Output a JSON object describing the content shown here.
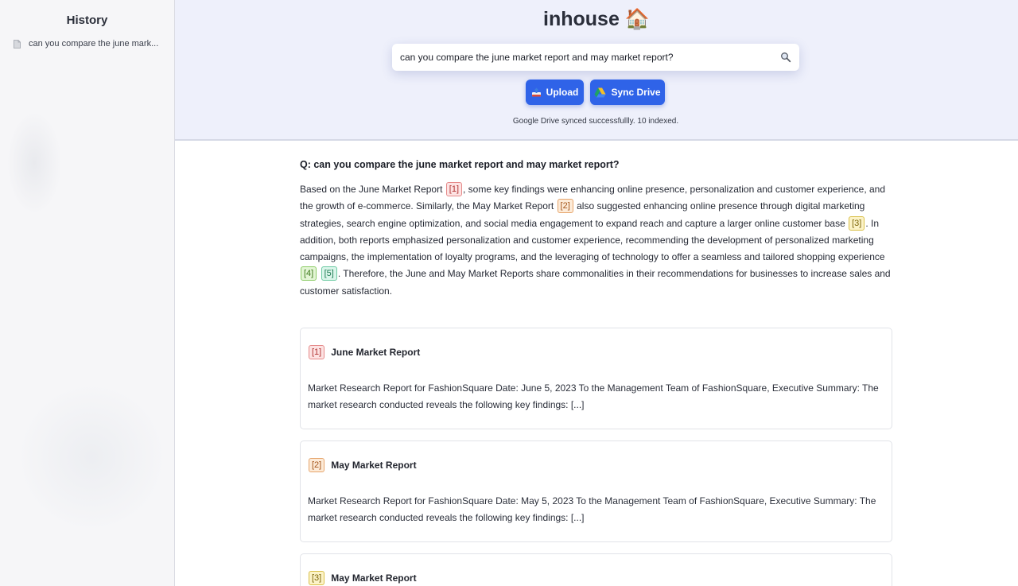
{
  "sidebar": {
    "title": "History",
    "items": [
      {
        "label": "can you compare the june mark..."
      }
    ]
  },
  "header": {
    "app_title": "inhouse 🏠",
    "search": {
      "value": "can you compare the june market report and may market report?"
    },
    "upload_label": "Upload",
    "sync_label": "Sync Drive",
    "status": "Google Drive synced successfullly. 10 indexed."
  },
  "result": {
    "question": "Q: can you compare the june market report and may market report?",
    "answer": [
      {
        "text": "Based on the June Market Report "
      },
      {
        "cite": "[1]",
        "color": "red"
      },
      {
        "text": ", some key findings were enhancing online presence, personalization and customer experience, and the growth of e-commerce. Similarly, the May Market Report "
      },
      {
        "cite": "[2]",
        "color": "orange"
      },
      {
        "text": " also suggested enhancing online presence through digital marketing strategies, search engine optimization, and social media engagement to expand reach and capture a larger online customer base "
      },
      {
        "cite": "[3]",
        "color": "yellow"
      },
      {
        "text": ". In addition, both reports emphasized personalization and customer experience, recommending the development of personalized marketing campaigns, the implementation of loyalty programs, and the leveraging of technology to offer a seamless and tailored shopping experience "
      },
      {
        "cite": "[4]",
        "color": "green"
      },
      {
        "text": " "
      },
      {
        "cite": "[5]",
        "color": "teal"
      },
      {
        "text": ". Therefore, the June and May Market Reports share commonalities in their recommendations for businesses to increase sales and customer satisfaction."
      }
    ]
  },
  "sources": [
    {
      "cite": "[1]",
      "color": "red",
      "title": "June Market Report",
      "snippet": "Market Research Report for FashionSquare Date: June 5, 2023 To the Management Team of FashionSquare, Executive Summary: The market research conducted reveals the following key findings: [...]"
    },
    {
      "cite": "[2]",
      "color": "orange",
      "title": "May Market Report",
      "snippet": "Market Research Report for FashionSquare Date: May 5, 2023 To the Management Team of FashionSquare, Executive Summary: The market research conducted reveals the following key findings: [...]"
    },
    {
      "cite": "[3]",
      "color": "yellow",
      "title": "May Market Report",
      "snippet": ""
    }
  ],
  "colors": {
    "accent": "#2f63e8",
    "header_bg": "#eef0fb",
    "sidebar_bg": "#f6f6f8"
  }
}
